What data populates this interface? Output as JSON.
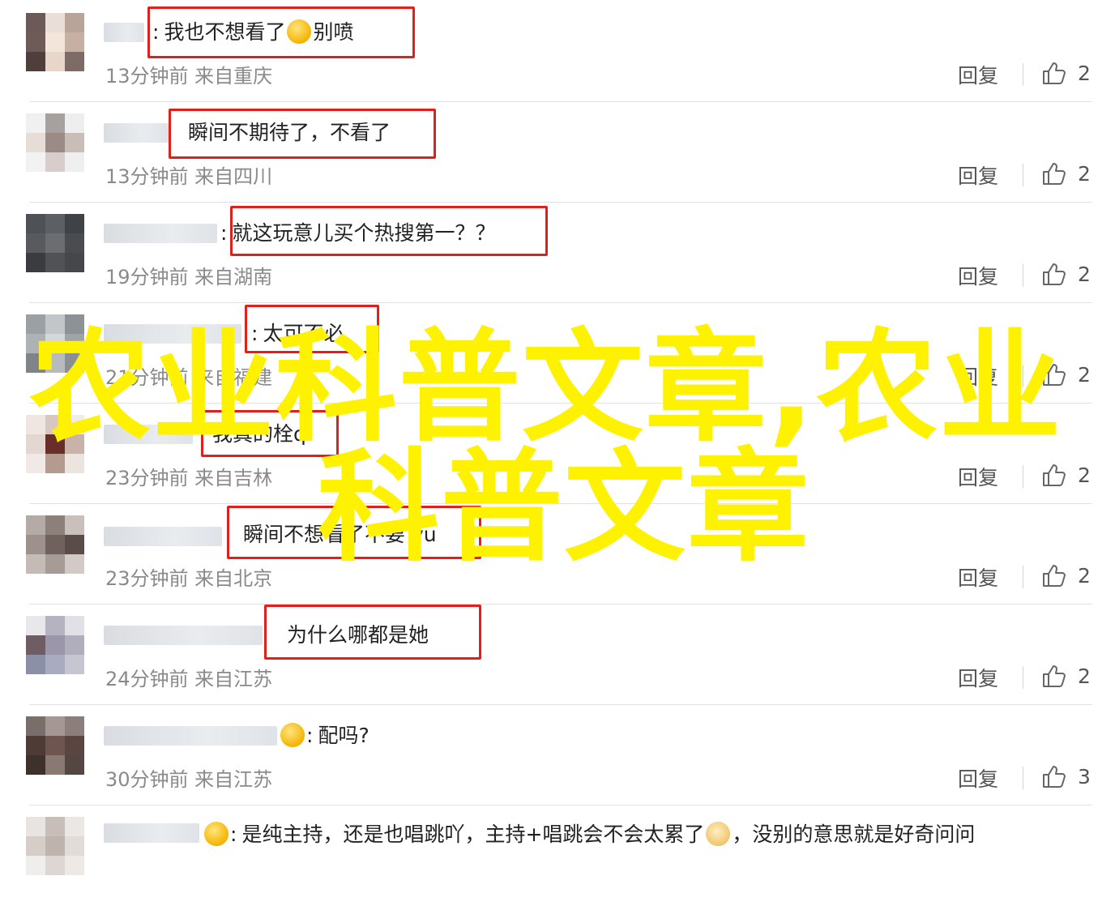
{
  "overlay_title": {
    "line1": "农业科普文章,农业",
    "line2": "科普文章"
  },
  "reply_label": "回复",
  "colors": {
    "highlight_box": "#e0201b",
    "overlay_text": "#fff200"
  },
  "comments": [
    {
      "text": "我也不想看了",
      "text_tail": "别喷",
      "meta": "13分钟前 来自重庆",
      "likes": "2"
    },
    {
      "text": "瞬间不期待了，不看了",
      "meta": "13分钟前 来自四川",
      "likes": "2"
    },
    {
      "text": "就这玩意儿买个热搜第一？？",
      "meta": "19分钟前 来自湖南",
      "likes": "2"
    },
    {
      "text": "太可不必",
      "meta": "21分钟前 来自福建",
      "likes": "2"
    },
    {
      "text": "我真的栓q",
      "meta": "23分钟前 来自吉林",
      "likes": "2"
    },
    {
      "text": "瞬间不想看了不要 yu",
      "meta": "23分钟前 来自北京",
      "likes": "2"
    },
    {
      "text": "为什么哪都是她",
      "meta": "24分钟前 来自江苏",
      "likes": "2"
    },
    {
      "text": "配吗?",
      "meta": "30分钟前 来自江苏",
      "likes": "3"
    },
    {
      "text": "是纯主持，还是也唱跳吖，主持+唱跳会不会太累了",
      "text_tail": "，没别的意思就是好奇问问"
    }
  ]
}
